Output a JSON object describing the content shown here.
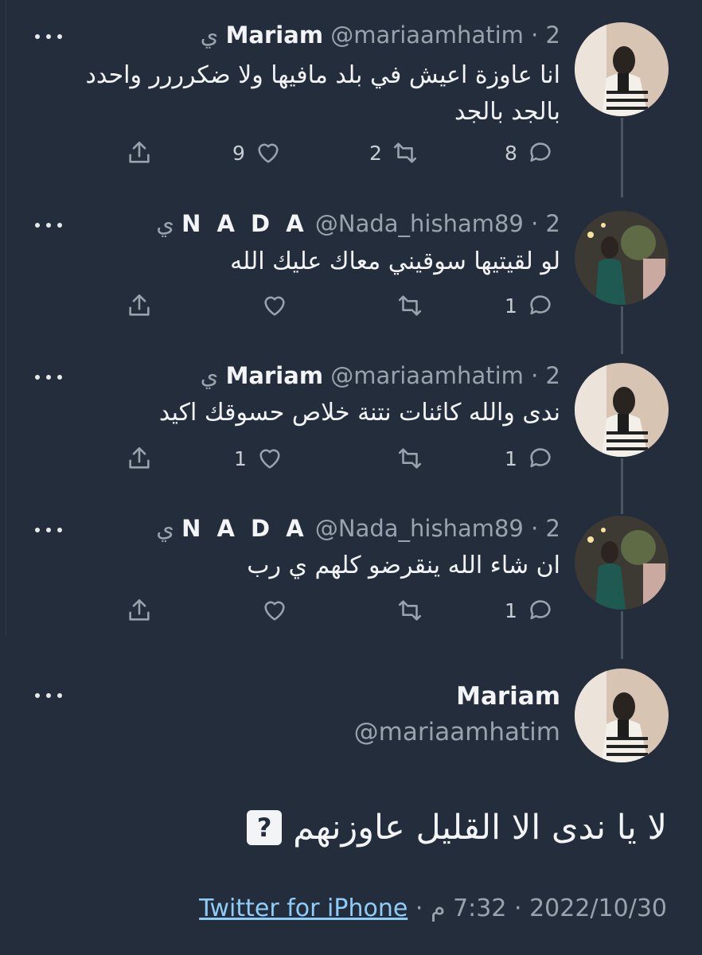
{
  "tweets": [
    {
      "name": "Mariam",
      "handle": "@mariaamhatim",
      "time": "2 ي",
      "text": "انا عاوزة اعيش في بلد مافيها ولا ضكرررر واحدد بالجد بالجد",
      "replies": "8",
      "retweets": "2",
      "likes": "9"
    },
    {
      "name": "N A D A",
      "handle": "@Nada_hisham89",
      "time": "2 ي",
      "text": "لو لقيتيها سوقيني معاك عليك الله",
      "replies": "1",
      "retweets": "",
      "likes": ""
    },
    {
      "name": "Mariam",
      "handle": "@mariaamhatim",
      "time": "2 ي",
      "text": "ندى والله كائنات نتنة خلاص حسوقك اكيد",
      "replies": "1",
      "retweets": "",
      "likes": "1"
    },
    {
      "name": "N A D A",
      "handle": "@Nada_hisham89",
      "time": "2 ي",
      "text": "ان شاء الله ينقرضو كلهم ي رب",
      "replies": "1",
      "retweets": "",
      "likes": ""
    }
  ],
  "main": {
    "name": "Mariam",
    "handle": "@mariaamhatim",
    "text": "لا يا ندى الا القليل عاوزنهم",
    "emoji": "?",
    "date": "2022/10/30",
    "time": "7:32 م",
    "source": "Twitter for iPhone"
  },
  "separator": "·",
  "colors": {
    "background": "#242d3c",
    "muted": "#9aa3ad",
    "link": "#8ecdf8",
    "thread_line": "#4b5563"
  },
  "icons": [
    "more-icon",
    "reply-icon",
    "retweet-icon",
    "like-icon",
    "share-icon"
  ]
}
